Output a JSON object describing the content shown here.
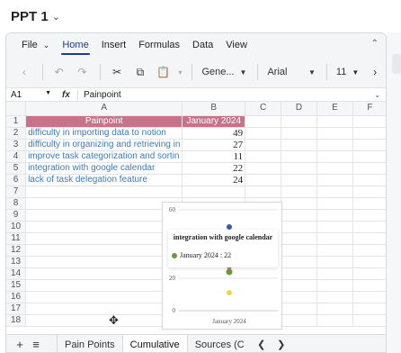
{
  "document": {
    "title": "PPT 1"
  },
  "menu": {
    "items": [
      {
        "label": "File",
        "has_caret": true
      },
      {
        "label": "Home",
        "active": true
      },
      {
        "label": "Insert"
      },
      {
        "label": "Formulas"
      },
      {
        "label": "Data"
      },
      {
        "label": "View"
      }
    ]
  },
  "toolbar": {
    "font_style": "Gene...",
    "font_name": "Arial",
    "font_size": "11"
  },
  "formula_bar": {
    "cell_ref": "A1",
    "fx_label": "fx",
    "content": "Painpoint"
  },
  "grid": {
    "columns": [
      "A",
      "B",
      "C",
      "D",
      "E",
      "F"
    ],
    "row_numbers": [
      "1",
      "2",
      "3",
      "4",
      "5",
      "6",
      "7",
      "8",
      "9",
      "10",
      "11",
      "12",
      "13",
      "14",
      "15",
      "16",
      "17",
      "18"
    ],
    "header": [
      "Painpoint",
      "January 2024"
    ],
    "rows": [
      {
        "pain": "difficulty in importing data to notion",
        "value": "49"
      },
      {
        "pain": "difficulty in organizing and retrieving in",
        "value": "27"
      },
      {
        "pain": "improve task categorization and sortin",
        "value": "11"
      },
      {
        "pain": "integration with google calendar",
        "value": "22"
      },
      {
        "pain": "lack of task delegation feature",
        "value": "24"
      }
    ]
  },
  "chart": {
    "y_ticks": [
      "60",
      "20",
      "0"
    ],
    "x_category": "January 2024",
    "tooltip_title": "integration with google calendar",
    "tooltip_value": "January 2024 : 22",
    "colors": {
      "tooltip_dot": "#6a9a3a",
      "series_blue": "#3a5aa8",
      "series_yellow": "#e6d84a",
      "series_pink": "#d66a9a"
    }
  },
  "sheets": {
    "tabs": [
      {
        "label": "Pain Points"
      },
      {
        "label": "Cumulative",
        "active": true
      },
      {
        "label": "Sources (C"
      }
    ],
    "add_icon": "plus-icon",
    "list_icon": "hamburger-icon"
  },
  "colors": {
    "header_fill": "#c9728a",
    "text_link_blue": "#3b7bbf",
    "home_active": "#1a3a8a"
  }
}
